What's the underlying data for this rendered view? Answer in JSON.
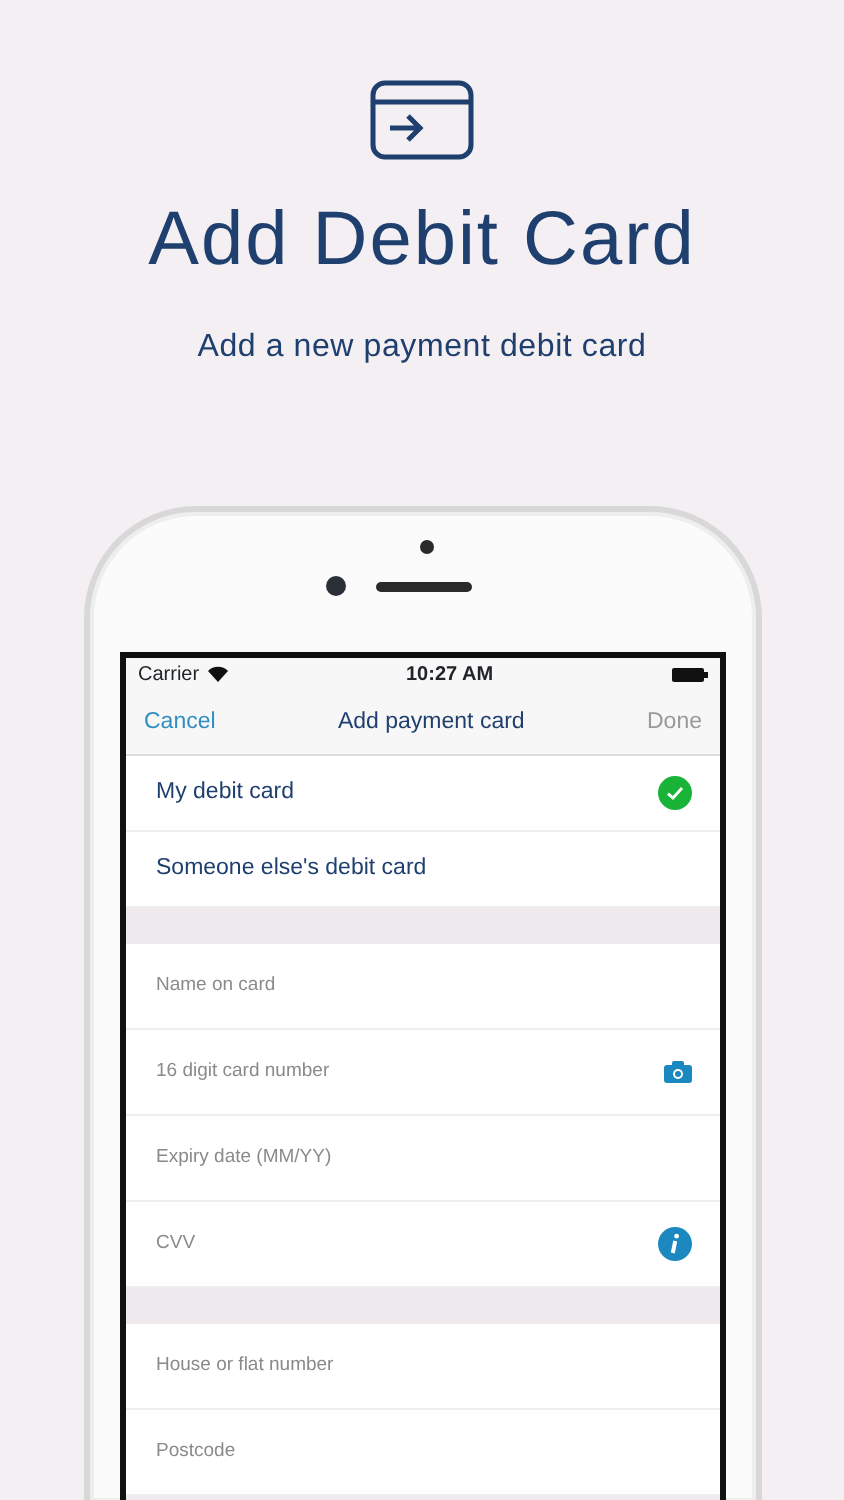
{
  "header": {
    "title": "Add Debit Card",
    "subtitle": "Add a new payment debit card"
  },
  "status_bar": {
    "carrier": "Carrier",
    "time": "10:27 AM"
  },
  "nav": {
    "cancel": "Cancel",
    "title": "Add payment card",
    "done": "Done",
    "done_disabled": true
  },
  "card_owner": [
    {
      "label": "My debit card",
      "selected": true
    },
    {
      "label": "Someone else's debit card",
      "selected": false
    }
  ],
  "sections": [
    {
      "fields": [
        {
          "placeholder": "Name on card",
          "kind": "plain"
        },
        {
          "placeholder": "16 digit card number",
          "kind": "camera"
        },
        {
          "placeholder": "Expiry date (MM/YY)",
          "kind": "plain"
        },
        {
          "placeholder": "CVV",
          "kind": "info"
        }
      ]
    },
    {
      "fields": [
        {
          "placeholder": "House or flat number",
          "kind": "plain"
        },
        {
          "placeholder": "Postcode",
          "kind": "plain"
        }
      ]
    }
  ]
}
